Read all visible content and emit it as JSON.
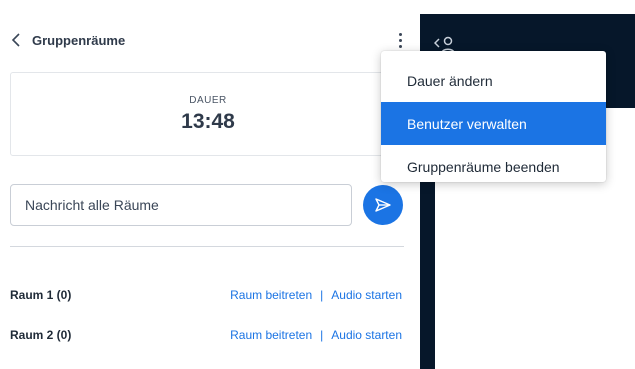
{
  "header": {
    "back_label": "Gruppenräume"
  },
  "timer": {
    "label": "DAUER",
    "value": "13:48"
  },
  "message": {
    "placeholder": "Nachricht alle Räume"
  },
  "rooms": [
    {
      "name": "Raum 1 (0)",
      "join_label": "Raum beitreten",
      "separator": "|",
      "audio_label": "Audio starten"
    },
    {
      "name": "Raum 2 (0)",
      "join_label": "Raum beitreten",
      "separator": "|",
      "audio_label": "Audio starten"
    }
  ],
  "menu": {
    "items": [
      {
        "label": "Dauer ändern",
        "active": false
      },
      {
        "label": "Benutzer verwalten",
        "active": true
      },
      {
        "label": "Gruppenräume beenden",
        "active": false
      }
    ]
  },
  "colors": {
    "accent": "#1b74e4",
    "dark_bg": "#06172a"
  },
  "icons": {
    "back": "chevron-left-icon",
    "more": "kebab-icon",
    "send": "send-icon",
    "user": "user-icon"
  }
}
